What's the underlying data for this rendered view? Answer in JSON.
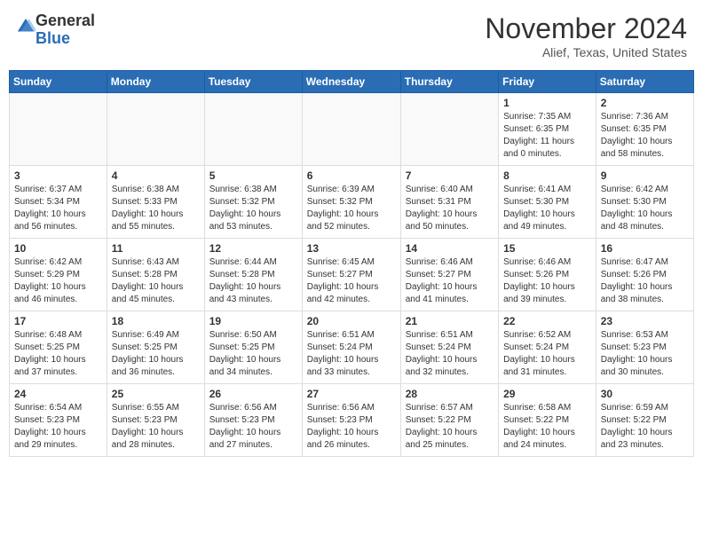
{
  "header": {
    "logo_general": "General",
    "logo_blue": "Blue",
    "month_title": "November 2024",
    "location": "Alief, Texas, United States"
  },
  "weekdays": [
    "Sunday",
    "Monday",
    "Tuesday",
    "Wednesday",
    "Thursday",
    "Friday",
    "Saturday"
  ],
  "weeks": [
    [
      {
        "day": "",
        "info": ""
      },
      {
        "day": "",
        "info": ""
      },
      {
        "day": "",
        "info": ""
      },
      {
        "day": "",
        "info": ""
      },
      {
        "day": "",
        "info": ""
      },
      {
        "day": "1",
        "info": "Sunrise: 7:35 AM\nSunset: 6:35 PM\nDaylight: 11 hours\nand 0 minutes."
      },
      {
        "day": "2",
        "info": "Sunrise: 7:36 AM\nSunset: 6:35 PM\nDaylight: 10 hours\nand 58 minutes."
      }
    ],
    [
      {
        "day": "3",
        "info": "Sunrise: 6:37 AM\nSunset: 5:34 PM\nDaylight: 10 hours\nand 56 minutes."
      },
      {
        "day": "4",
        "info": "Sunrise: 6:38 AM\nSunset: 5:33 PM\nDaylight: 10 hours\nand 55 minutes."
      },
      {
        "day": "5",
        "info": "Sunrise: 6:38 AM\nSunset: 5:32 PM\nDaylight: 10 hours\nand 53 minutes."
      },
      {
        "day": "6",
        "info": "Sunrise: 6:39 AM\nSunset: 5:32 PM\nDaylight: 10 hours\nand 52 minutes."
      },
      {
        "day": "7",
        "info": "Sunrise: 6:40 AM\nSunset: 5:31 PM\nDaylight: 10 hours\nand 50 minutes."
      },
      {
        "day": "8",
        "info": "Sunrise: 6:41 AM\nSunset: 5:30 PM\nDaylight: 10 hours\nand 49 minutes."
      },
      {
        "day": "9",
        "info": "Sunrise: 6:42 AM\nSunset: 5:30 PM\nDaylight: 10 hours\nand 48 minutes."
      }
    ],
    [
      {
        "day": "10",
        "info": "Sunrise: 6:42 AM\nSunset: 5:29 PM\nDaylight: 10 hours\nand 46 minutes."
      },
      {
        "day": "11",
        "info": "Sunrise: 6:43 AM\nSunset: 5:28 PM\nDaylight: 10 hours\nand 45 minutes."
      },
      {
        "day": "12",
        "info": "Sunrise: 6:44 AM\nSunset: 5:28 PM\nDaylight: 10 hours\nand 43 minutes."
      },
      {
        "day": "13",
        "info": "Sunrise: 6:45 AM\nSunset: 5:27 PM\nDaylight: 10 hours\nand 42 minutes."
      },
      {
        "day": "14",
        "info": "Sunrise: 6:46 AM\nSunset: 5:27 PM\nDaylight: 10 hours\nand 41 minutes."
      },
      {
        "day": "15",
        "info": "Sunrise: 6:46 AM\nSunset: 5:26 PM\nDaylight: 10 hours\nand 39 minutes."
      },
      {
        "day": "16",
        "info": "Sunrise: 6:47 AM\nSunset: 5:26 PM\nDaylight: 10 hours\nand 38 minutes."
      }
    ],
    [
      {
        "day": "17",
        "info": "Sunrise: 6:48 AM\nSunset: 5:25 PM\nDaylight: 10 hours\nand 37 minutes."
      },
      {
        "day": "18",
        "info": "Sunrise: 6:49 AM\nSunset: 5:25 PM\nDaylight: 10 hours\nand 36 minutes."
      },
      {
        "day": "19",
        "info": "Sunrise: 6:50 AM\nSunset: 5:25 PM\nDaylight: 10 hours\nand 34 minutes."
      },
      {
        "day": "20",
        "info": "Sunrise: 6:51 AM\nSunset: 5:24 PM\nDaylight: 10 hours\nand 33 minutes."
      },
      {
        "day": "21",
        "info": "Sunrise: 6:51 AM\nSunset: 5:24 PM\nDaylight: 10 hours\nand 32 minutes."
      },
      {
        "day": "22",
        "info": "Sunrise: 6:52 AM\nSunset: 5:24 PM\nDaylight: 10 hours\nand 31 minutes."
      },
      {
        "day": "23",
        "info": "Sunrise: 6:53 AM\nSunset: 5:23 PM\nDaylight: 10 hours\nand 30 minutes."
      }
    ],
    [
      {
        "day": "24",
        "info": "Sunrise: 6:54 AM\nSunset: 5:23 PM\nDaylight: 10 hours\nand 29 minutes."
      },
      {
        "day": "25",
        "info": "Sunrise: 6:55 AM\nSunset: 5:23 PM\nDaylight: 10 hours\nand 28 minutes."
      },
      {
        "day": "26",
        "info": "Sunrise: 6:56 AM\nSunset: 5:23 PM\nDaylight: 10 hours\nand 27 minutes."
      },
      {
        "day": "27",
        "info": "Sunrise: 6:56 AM\nSunset: 5:23 PM\nDaylight: 10 hours\nand 26 minutes."
      },
      {
        "day": "28",
        "info": "Sunrise: 6:57 AM\nSunset: 5:22 PM\nDaylight: 10 hours\nand 25 minutes."
      },
      {
        "day": "29",
        "info": "Sunrise: 6:58 AM\nSunset: 5:22 PM\nDaylight: 10 hours\nand 24 minutes."
      },
      {
        "day": "30",
        "info": "Sunrise: 6:59 AM\nSunset: 5:22 PM\nDaylight: 10 hours\nand 23 minutes."
      }
    ]
  ]
}
